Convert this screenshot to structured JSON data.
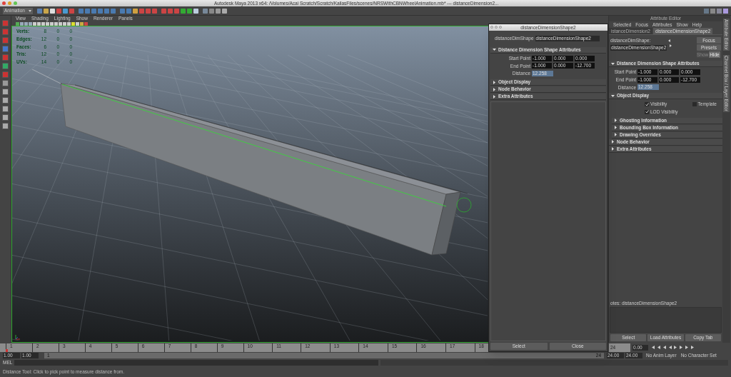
{
  "window": {
    "title": "Autodesk Maya 2013 x64: /Volumes/Acai Scratch/Scratch/KailasFiles/scenes/NRSWithCBNWheelAnimation.mb* --- distanceDimension2..."
  },
  "mode_menu": {
    "value": "Animation"
  },
  "viewport": {
    "menus": [
      "View",
      "Shading",
      "Lighting",
      "Show",
      "Renderer",
      "Panels"
    ],
    "hud": [
      {
        "label": "Verts:",
        "values": [
          "8",
          "0",
          "0"
        ]
      },
      {
        "label": "Edges:",
        "values": [
          "12",
          "0",
          "0"
        ]
      },
      {
        "label": "Faces:",
        "values": [
          "6",
          "0",
          "0"
        ]
      },
      {
        "label": "Tris:",
        "values": [
          "12",
          "0",
          "0"
        ]
      },
      {
        "label": "UVs:",
        "values": [
          "14",
          "0",
          "0"
        ]
      }
    ]
  },
  "float_window": {
    "title": "distanceDimensionShape2",
    "field_label": "distanceDimShape",
    "field_value": "distanceDimensionShape2",
    "sections": [
      {
        "title": "Distance Dimension Shape Attributes",
        "expanded": true,
        "kind": "attrs",
        "rows": [
          {
            "label": "Start Point",
            "kind": "vector",
            "values": [
              "-1.000",
              "0.000",
              "0.000"
            ]
          },
          {
            "label": "End Point",
            "kind": "vector",
            "values": [
              "-1.000",
              "0.000",
              "-12.700"
            ]
          },
          {
            "label": "Distance",
            "kind": "readonly",
            "values": [
              "12.258"
            ]
          }
        ]
      },
      {
        "title": "Object Display",
        "expanded": false
      },
      {
        "title": "Node Behavior",
        "expanded": false
      },
      {
        "title": "Extra Attributes",
        "expanded": false
      }
    ],
    "buttons": [
      "Select",
      "Close"
    ]
  },
  "attribute_editor": {
    "header": "Attribute Editor",
    "menus": [
      "Selected",
      "Focus",
      "Attributes",
      "Show",
      "Help"
    ],
    "tabs": [
      {
        "label": "istanceDimension2",
        "selected": false
      },
      {
        "label": "distanceDimensionShape2",
        "selected": true
      }
    ],
    "field_label": "distanceDimShape:",
    "field_value": "distanceDimensionShape2",
    "side_buttons": [
      {
        "label": "Focus",
        "selected": false
      },
      {
        "label": "Presets",
        "selected": false
      }
    ],
    "toggle_buttons": [
      {
        "label": "Show",
        "selected": false
      },
      {
        "label": "Hide",
        "selected": true
      }
    ],
    "sections": [
      {
        "title": "Distance Dimension Shape Attributes",
        "expanded": true,
        "kind": "attrs",
        "rows": [
          {
            "label": "Start Point",
            "kind": "vector",
            "values": [
              "-1.000",
              "0.000",
              "0.000"
            ]
          },
          {
            "label": "End Point",
            "kind": "vector",
            "values": [
              "-1.000",
              "0.000",
              "-12.700"
            ]
          },
          {
            "label": "Distance",
            "kind": "readonly",
            "values": [
              "12.258"
            ]
          }
        ]
      },
      {
        "title": "Object Display",
        "expanded": true,
        "kind": "display",
        "checks": [
          {
            "label": "Visibility",
            "checked": true
          },
          {
            "label": "Template",
            "checked": false
          },
          {
            "label": "LOD Visibility",
            "checked": true
          }
        ],
        "children": [
          {
            "title": "Ghosting Information",
            "expanded": false
          },
          {
            "title": "Bounding Box Information",
            "expanded": false
          },
          {
            "title": "Drawing Overrides",
            "expanded": false
          }
        ]
      },
      {
        "title": "Node Behavior",
        "expanded": false
      },
      {
        "title": "Extra Attributes",
        "expanded": false
      }
    ],
    "notes_label": "otes:  distanceDimensionShape2",
    "buttons": [
      "Select",
      "Load Attributes",
      "Copy Tab"
    ]
  },
  "side_tabs": [
    "Attribute Editor",
    "Channel Box / Layer Editor"
  ],
  "timeline": {
    "ticks": [
      "1",
      "2",
      "3",
      "4",
      "5",
      "6",
      "7",
      "8",
      "9",
      "10",
      "11",
      "12",
      "13",
      "14",
      "15",
      "16",
      "17",
      "18"
    ],
    "level": 0,
    "end_tick": "24",
    "current_time": "0.00"
  },
  "range": {
    "start": "1.00",
    "inner_start": "1.00",
    "slider_start": "1",
    "slider_end": "24",
    "level": 1,
    "inner_end": "24.00",
    "end": "24.00",
    "anim_layer": "No Anim Layer",
    "character_set": "No Character Set"
  },
  "command_line": {
    "label": "MEL"
  },
  "status_line": "Distance Tool: Click to pick point to measure distance from."
}
